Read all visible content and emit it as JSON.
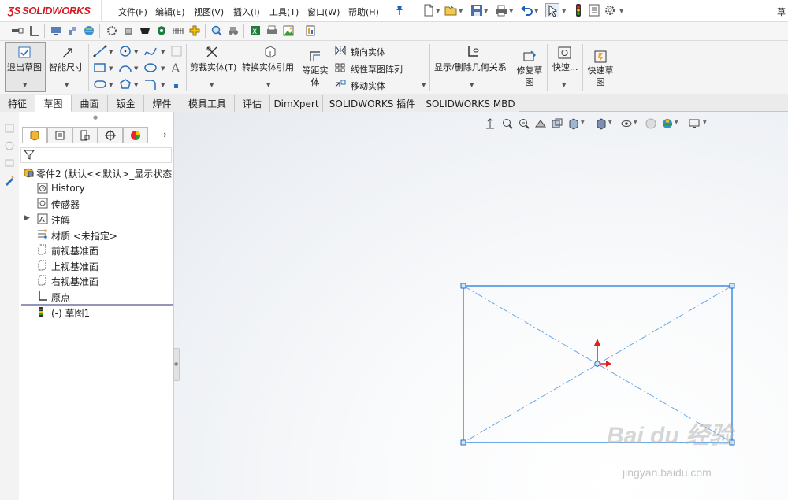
{
  "app": {
    "logo": "SOLIDWORKS",
    "title_fragment": "草"
  },
  "menu": [
    "文件(F)",
    "编辑(E)",
    "视图(V)",
    "插入(I)",
    "工具(T)",
    "窗口(W)",
    "帮助(H)"
  ],
  "ribbon": {
    "exit_sketch": "退出草图",
    "smart_dimension": "智能尺寸",
    "trim_entities": "剪裁实体(T)",
    "convert_entities": "转换实体引用",
    "offset_entities": "等距实\n体",
    "mirror_entities": "镜向实体",
    "linear_pattern": "线性草图阵列",
    "move_entities": "移动实体",
    "display_relations": "显示/删除几何关系",
    "repair_sketch": "修复草\n图",
    "quick_snaps": "快速...",
    "rapid_sketch": "快速草\n图"
  },
  "tabs": [
    {
      "label": "特征",
      "active": false
    },
    {
      "label": "草图",
      "active": true
    },
    {
      "label": "曲面",
      "active": false
    },
    {
      "label": "钣金",
      "active": false
    },
    {
      "label": "焊件",
      "active": false
    },
    {
      "label": "模具工具",
      "active": false
    },
    {
      "label": "评估",
      "active": false
    },
    {
      "label": "DimXpert",
      "active": false
    },
    {
      "label": "SOLIDWORKS 插件",
      "active": false
    },
    {
      "label": "SOLIDWORKS MBD",
      "active": false
    }
  ],
  "tree": {
    "part": "零件2 (默认<<默认>_显示状态",
    "items": [
      {
        "label": "History",
        "icon": "history-icon",
        "expandable": false
      },
      {
        "label": "传感器",
        "icon": "sensor-icon",
        "expandable": false
      },
      {
        "label": "注解",
        "icon": "annotation-icon",
        "expandable": true
      },
      {
        "label": "材质 <未指定>",
        "icon": "material-icon",
        "expandable": false
      },
      {
        "label": "前视基准面",
        "icon": "plane-icon",
        "expandable": false
      },
      {
        "label": "上视基准面",
        "icon": "plane-icon",
        "expandable": false
      },
      {
        "label": "右视基准面",
        "icon": "plane-icon",
        "expandable": false
      },
      {
        "label": "原点",
        "icon": "origin-icon",
        "expandable": false
      },
      {
        "label": "(-) 草图1",
        "icon": "sketch-icon",
        "expandable": false
      }
    ]
  },
  "watermark": {
    "brand": "Bai du 经验",
    "url": "jingyan.baidu.com"
  },
  "colors": {
    "sketch_line": "#3d8ee6",
    "centerline": "#6aa6e8",
    "origin_red": "#e0201b",
    "logo_red": "#d71920"
  }
}
